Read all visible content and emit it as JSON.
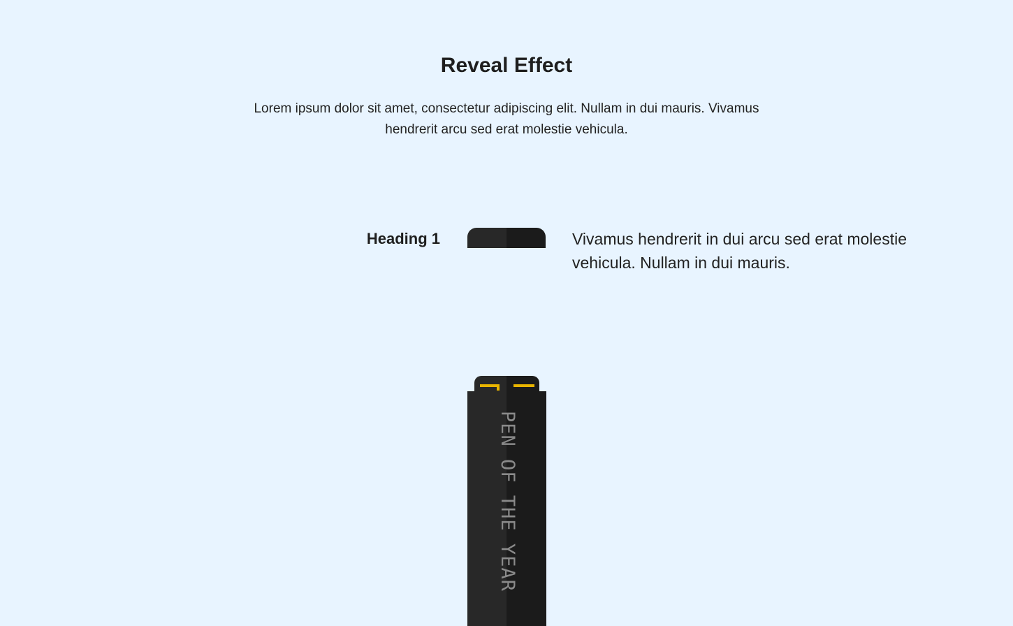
{
  "header": {
    "title": "Reveal Effect",
    "intro": "Lorem ipsum dolor sit amet, consectetur adipiscing elit. Nullam in dui mauris. Vivamus hendrerit arcu sed erat molestie vehicula."
  },
  "section": {
    "heading": "Heading 1",
    "text": "Vivamus hendrerit in dui arcu sed erat molestie vehicula. Nullam in dui mauris."
  },
  "pen": {
    "label": "PEN OF THE YEAR"
  },
  "colors": {
    "background": "#e8f4ff",
    "pen_dark": "#1b1b1b",
    "pen_light": "#282828",
    "accent": "#e8b400",
    "label": "#8a8a8a"
  }
}
